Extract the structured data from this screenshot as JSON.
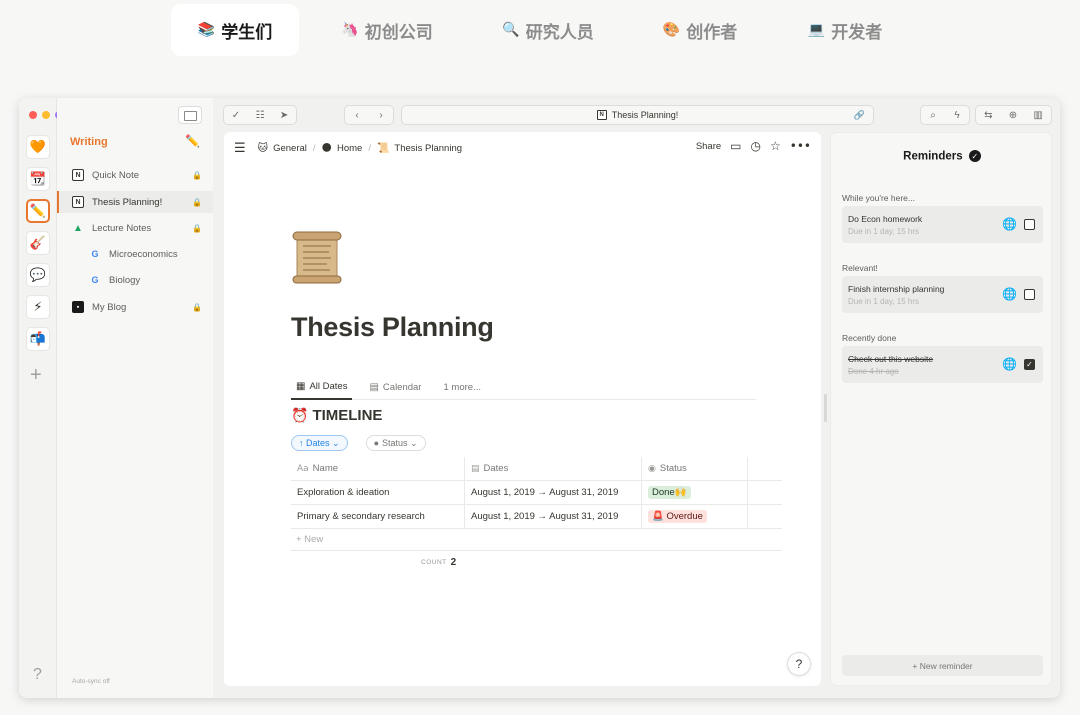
{
  "category_tabs": [
    {
      "emoji": "📚",
      "label": "学生们"
    },
    {
      "emoji": "🦄",
      "label": "初创公司"
    },
    {
      "emoji": "🔍",
      "label": "研究人员"
    },
    {
      "emoji": "🎨",
      "label": "创作者"
    },
    {
      "emoji": "💻",
      "label": "开发者"
    }
  ],
  "rail": {
    "icons": [
      "🧡",
      "📆",
      "✏️",
      "🎸",
      "💬",
      "⚡",
      "📬"
    ],
    "plus": "+",
    "help": "?"
  },
  "sidebar": {
    "heading": "Writing",
    "edit_icon": "✏️",
    "items": [
      {
        "label": "Quick Note",
        "icon": "N"
      },
      {
        "label": "Thesis Planning!",
        "icon": "N"
      },
      {
        "label": "Lecture Notes",
        "icon": "▲"
      },
      {
        "label": "Microeconomics",
        "icon": "G"
      },
      {
        "label": "Biology",
        "icon": "G"
      },
      {
        "label": "My Blog",
        "icon": "▪"
      }
    ],
    "footer": "Auto-sync off"
  },
  "toolbar": {
    "url_icon": "N",
    "url": "Thesis Planning!"
  },
  "breadcrumb": {
    "items": [
      {
        "icon": "🐱",
        "label": "General"
      },
      {
        "icon": "🌑",
        "label": "Home"
      },
      {
        "icon": "📜",
        "label": "Thesis Planning"
      }
    ],
    "separator": "/"
  },
  "page_actions": {
    "share": "Share"
  },
  "page": {
    "title": "Thesis Planning",
    "views": [
      "All Dates",
      "Calendar",
      "1 more..."
    ],
    "database_icon": "⏰",
    "database_title": "TIMELINE",
    "filters": {
      "dates": "↑ Dates ⌄",
      "status": "Status ⌄"
    },
    "columns": {
      "name": "Name",
      "dates": "Dates",
      "status": "Status"
    },
    "rows": [
      {
        "name": "Exploration & ideation",
        "dates": "August 1, 2019 → August 31, 2019",
        "status": "Done🙌"
      },
      {
        "name": "Primary & secondary research",
        "dates": "August 1, 2019 → August 31, 2019",
        "status": "🚨 Overdue"
      }
    ],
    "new_row": "+ New",
    "count_label": "COUNT",
    "count_value": "2",
    "help": "?"
  },
  "reminders": {
    "title": "Reminders",
    "sections": [
      {
        "label": "While you're here...",
        "item": {
          "title": "Do Econ homework",
          "subtitle": "Due in 1 day, 15 hrs",
          "done": false
        }
      },
      {
        "label": "Relevant!",
        "item": {
          "title": "Finish internship planning",
          "subtitle": "Due in 1 day, 15 hrs",
          "done": false
        }
      },
      {
        "label": "Recently done",
        "item": {
          "title": "Check out this website",
          "subtitle": "Done 4 hr ago",
          "done": true
        }
      }
    ],
    "new_button": "+ New reminder"
  },
  "colors": {
    "accent": "#e8772e",
    "done_tag": "#dbeddb",
    "overdue_tag": "#ffe2dd",
    "traffic_red": "#ff5f57",
    "traffic_yellow": "#febc2e",
    "traffic_purple": "#a27cf0"
  }
}
